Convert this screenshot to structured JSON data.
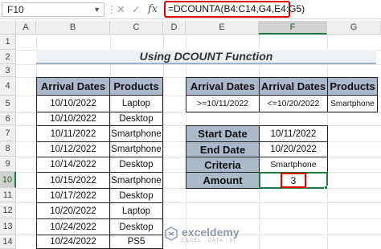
{
  "formula_bar": {
    "name_box": "F10",
    "formula": "=DCOUNTA(B4:C14,G4,E4:G5)"
  },
  "columns": [
    "A",
    "B",
    "C",
    "D",
    "E",
    "F",
    "G"
  ],
  "rows": [
    "1",
    "2",
    "3",
    "4",
    "5",
    "6",
    "7",
    "8",
    "9",
    "10",
    "11",
    "12",
    "13",
    "14"
  ],
  "title": "Using DCOUNT Function",
  "data_table": {
    "headers": [
      "Arrival Dates",
      "Products"
    ],
    "rows": [
      [
        "10/10/2022",
        "Laptop"
      ],
      [
        "10/10/2022",
        "Desktop"
      ],
      [
        "10/11/2022",
        "Smartphone"
      ],
      [
        "10/12/2022",
        "Smartphone"
      ],
      [
        "10/14/2022",
        "Desktop"
      ],
      [
        "10/15/2022",
        "Smartphone"
      ],
      [
        "10/17/2022",
        "Desktop"
      ],
      [
        "10/20/2022",
        "Laptop"
      ],
      [
        "10/24/2022",
        "Desktop"
      ],
      [
        "10/24/2022",
        "PS5"
      ]
    ]
  },
  "criteria_table": {
    "headers": [
      "Arrival Dates",
      "Arrival Dates",
      "Products"
    ],
    "row": [
      ">=10/11/2022",
      "<=10/20/2022",
      "Smartphone"
    ]
  },
  "summary": {
    "start_label": "Start Date",
    "start_value": "10/11/2022",
    "end_label": "End Date",
    "end_value": "10/20/2022",
    "criteria_label": "Criteria",
    "criteria_value": "Smartphone",
    "amount_label": "Amount",
    "amount_value": "3"
  },
  "watermark": {
    "name": "exceldemy",
    "sub": "EXCEL · DATA · BI"
  },
  "colors": {
    "header_fill": "#acb9ca",
    "highlight": "#e00000",
    "selected_header_text": "#1b5e20"
  }
}
